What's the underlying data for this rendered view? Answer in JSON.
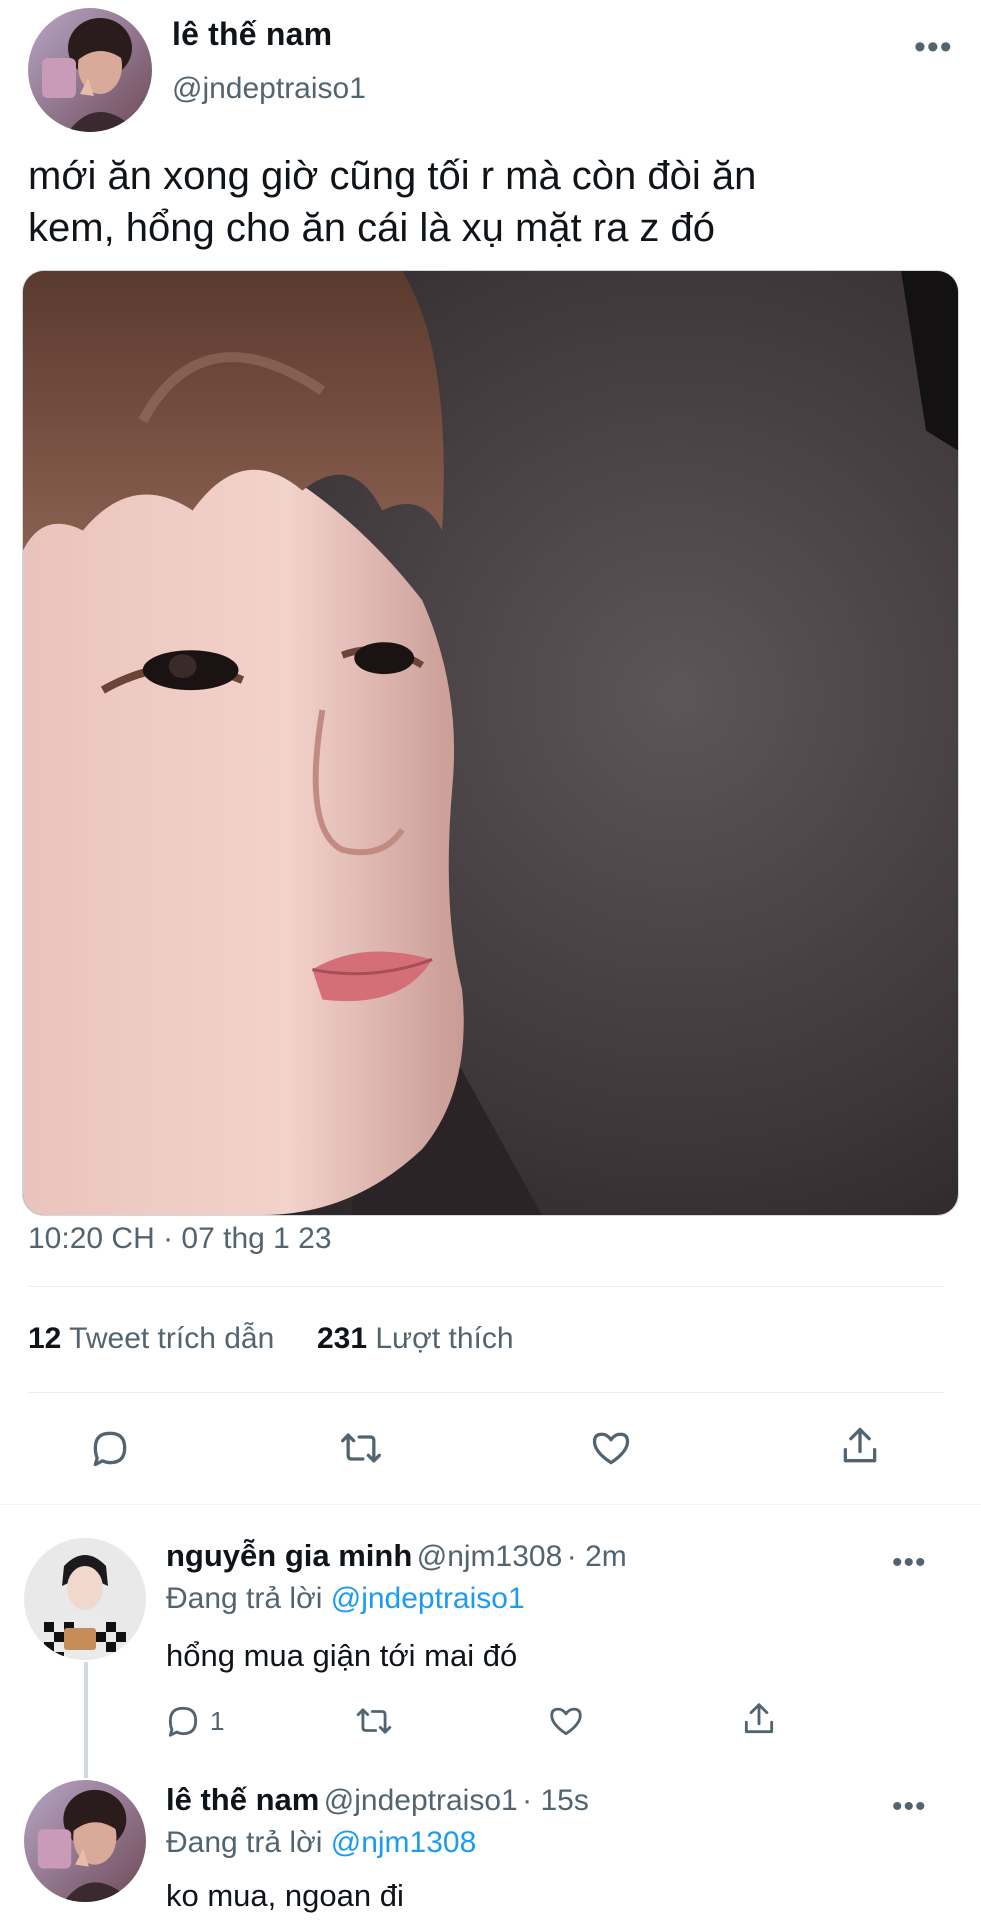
{
  "main_tweet": {
    "author_name": "lê thế nam",
    "author_handle": "@jndeptraiso1",
    "more_icon": "more-icon",
    "text_line1": "mới ăn xong giờ cũng tối r mà còn đòi ăn",
    "text_line2": "kem, hổng cho ăn cái là xụ mặt ra z đó",
    "timestamp": "10:20 CH · 07 thg 1 23",
    "quote_count": "12",
    "quote_label": "Tweet trích dẫn",
    "like_count": "231",
    "like_label": "Lượt thích"
  },
  "replies": [
    {
      "author_name": "nguyễn gia minh",
      "author_handle": "@njm1308",
      "time": "· 2m",
      "replying_prefix": "Đang trả lời",
      "replying_to": "@jndeptraiso1",
      "text": "hổng mua giận tới mai đó",
      "reply_count": "1"
    },
    {
      "author_name": "lê thế nam",
      "author_handle": "@jndeptraiso1",
      "time": "· 15s",
      "replying_prefix": "Đang trả lời",
      "replying_to": "@njm1308",
      "text": "ko mua, ngoan đi"
    }
  ],
  "colors": {
    "accent": "#1d9bf0",
    "secondary_text": "#536471",
    "primary_text": "#0f1419"
  }
}
